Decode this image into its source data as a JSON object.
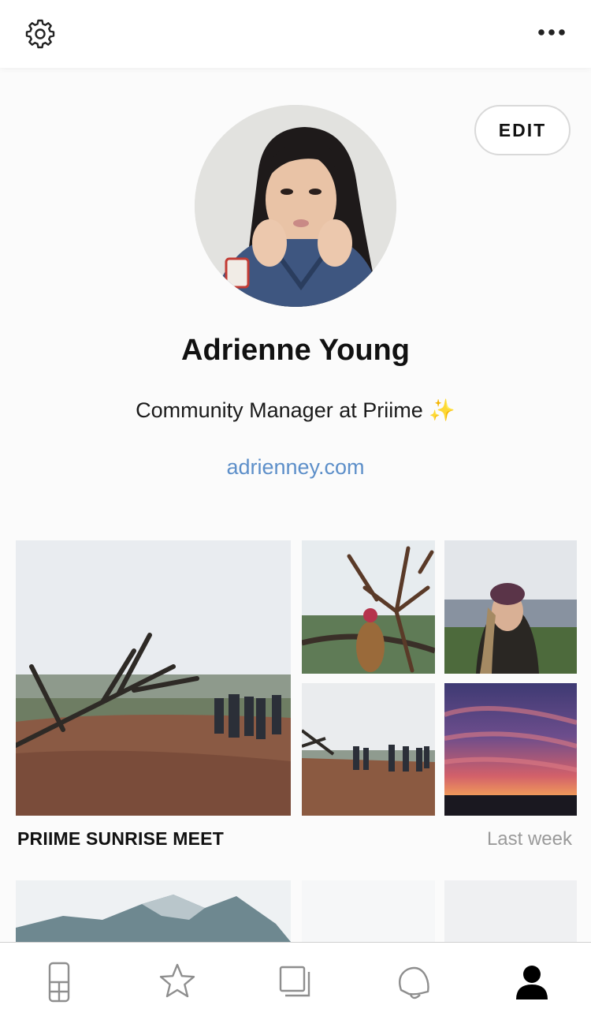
{
  "header": {
    "left_icon": "gear-icon",
    "right_icon": "more-icon"
  },
  "profile": {
    "edit_label": "EDIT",
    "name": "Adrienne Young",
    "bio": "Community Manager at Priime",
    "bio_emoji": "✨",
    "website": "adrienney.com",
    "link_color": "#5d8fc9"
  },
  "albums": [
    {
      "title": "PRIIME SUNRISE MEET",
      "time": "Last week"
    }
  ],
  "tabbar": {
    "items": [
      {
        "name": "phone-grid-icon",
        "active": false
      },
      {
        "name": "star-icon",
        "active": false
      },
      {
        "name": "layers-icon",
        "active": false
      },
      {
        "name": "bell-icon",
        "active": false
      },
      {
        "name": "profile-icon",
        "active": true
      }
    ],
    "active_color": "#000000",
    "inactive_color": "#8e8e8e"
  }
}
